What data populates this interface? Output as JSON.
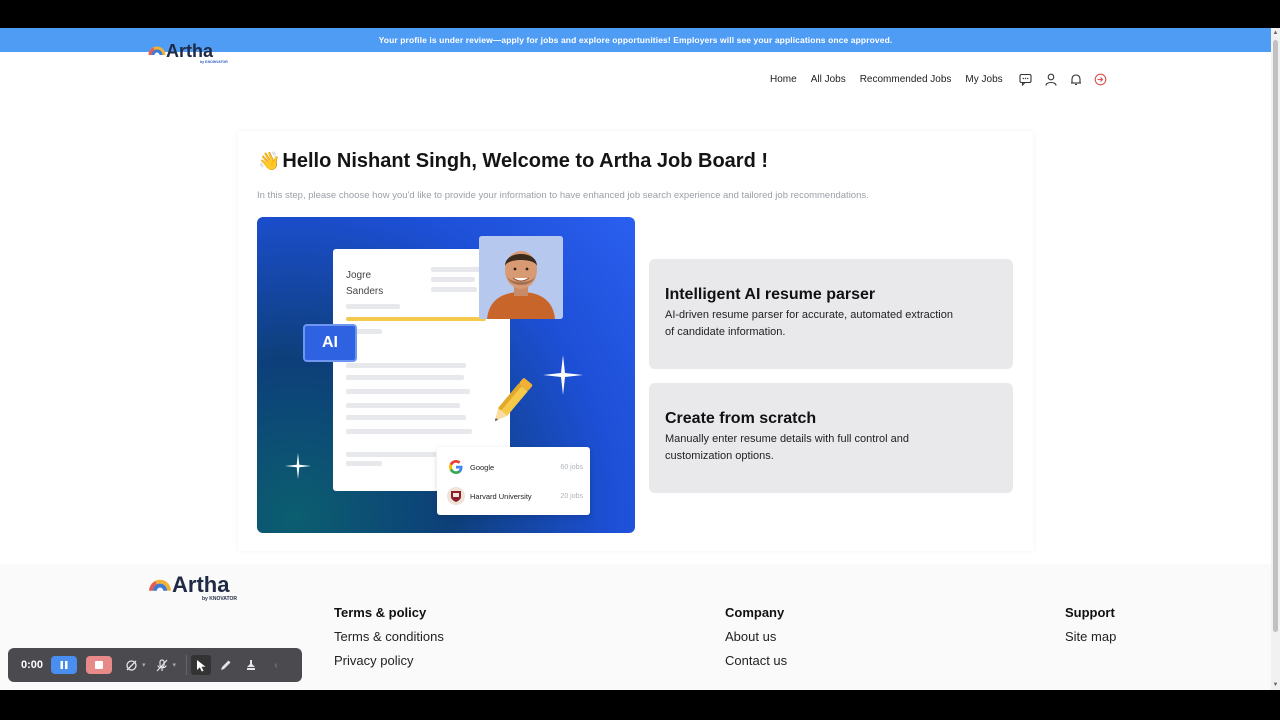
{
  "banner": {
    "text": "Your profile is under review—apply for jobs and explore opportunities! Employers will see your applications once approved."
  },
  "header": {
    "logo_text": "Artha",
    "logo_byline": "by KNOWVATOR",
    "nav": [
      {
        "label": "Home"
      },
      {
        "label": "All Jobs"
      },
      {
        "label": "Recommended Jobs"
      },
      {
        "label": "My Jobs"
      }
    ],
    "icons": [
      "chat-icon",
      "user-icon",
      "bell-icon",
      "logout-icon"
    ]
  },
  "main": {
    "greeting_emoji": "👋",
    "title": "Hello Nishant Singh, Welcome to Artha Job Board !",
    "subtitle": "In this step, please choose how you'd like to provide your information to have enhanced job search experience and tailored job recommendations.",
    "illustration": {
      "resume_name_line1": "Jogre",
      "resume_name_line2": "Sanders",
      "ai_badge": "AI",
      "jobs": [
        {
          "company": "Google",
          "count": "60 jobs"
        },
        {
          "company": "Harvard University",
          "count": "20 jobs"
        }
      ]
    },
    "options": [
      {
        "title": "Intelligent AI resume parser",
        "description": "AI-driven resume parser for accurate, automated extraction of candidate information."
      },
      {
        "title": "Create from scratch",
        "description": "Manually enter resume details with full control and customization options."
      }
    ]
  },
  "footer": {
    "logo_text": "Artha",
    "logo_byline": "by KNOVATOR",
    "columns": [
      {
        "heading": "Terms & policy",
        "links": [
          "Terms & conditions",
          "Privacy policy"
        ]
      },
      {
        "heading": "Company",
        "links": [
          "About us",
          "Contact us"
        ]
      },
      {
        "heading": "Support",
        "links": [
          "Site map"
        ]
      }
    ]
  },
  "recorder": {
    "time": "0:00"
  },
  "colors": {
    "banner": "#4f9cf5",
    "accent": "#2f62e0",
    "option_bg": "#e9e9ec"
  }
}
